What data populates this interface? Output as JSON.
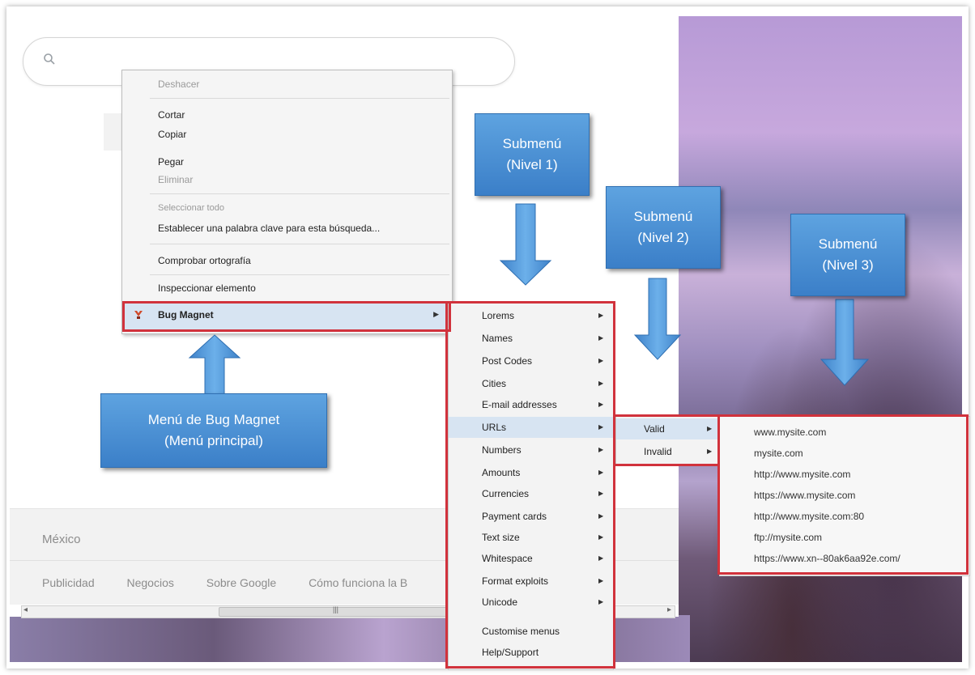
{
  "browser": {
    "footer_country": "México",
    "footer_links": [
      "Publicidad",
      "Negocios",
      "Sobre Google",
      "Cómo funciona la B"
    ]
  },
  "context_menu": {
    "items": [
      "Deshacer",
      "Cortar",
      "Copiar",
      "Pegar",
      "Eliminar",
      "Seleccionar todo",
      "Establecer una palabra clave para esta búsqueda...",
      "Comprobar ortografía",
      "Inspeccionar elemento"
    ],
    "bug_magnet": "Bug Magnet"
  },
  "submenu_level1": [
    "Lorems",
    "Names",
    "Post Codes",
    "Cities",
    "E-mail addresses",
    "URLs",
    "Numbers",
    "Amounts",
    "Currencies",
    "Payment cards",
    "Text size",
    "Whitespace",
    "Format exploits",
    "Unicode",
    "Customise menus",
    "Help/Support"
  ],
  "submenu_level2": [
    "Valid",
    "Invalid"
  ],
  "submenu_level3": [
    "www.mysite.com",
    "mysite.com",
    "http://www.mysite.com",
    "https://www.mysite.com",
    "http://www.mysite.com:80",
    "ftp://mysite.com",
    "https://www.xn--80ak6aa92e.com/"
  ],
  "callouts": {
    "main_line1": "Menú de Bug Magnet",
    "main_line2": "(Menú principal)",
    "l1_line1": "Submenú",
    "l1_line2": "(Nivel 1)",
    "l2_line1": "Submenú",
    "l2_line2": "(Nivel 2)",
    "l3_line1": "Submenú",
    "l3_line2": "(Nivel 3)"
  },
  "colors": {
    "highlight_red": "#d1323c",
    "callout_blue": "#3b7fc8",
    "menu_hover": "#d7e4f2"
  }
}
